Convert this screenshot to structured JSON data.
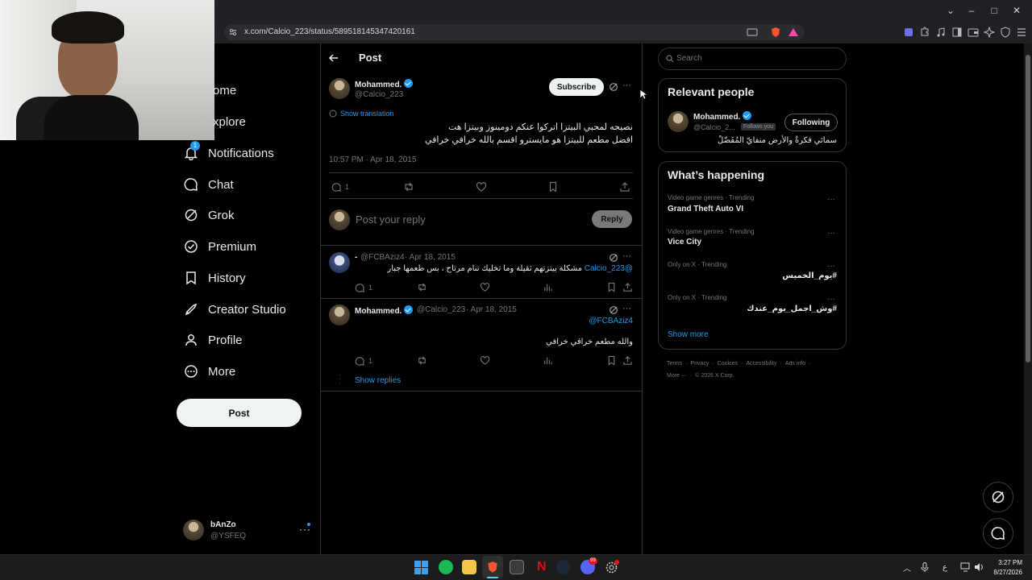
{
  "browser": {
    "url": "x.com/Calcio_223/status/589518145347420161"
  },
  "nav": {
    "items": [
      {
        "label": "Home",
        "visible_label": "ome",
        "icon": "home-icon"
      },
      {
        "label": "Explore",
        "visible_label": "xplore",
        "icon": "search-icon"
      },
      {
        "label": "Notifications",
        "icon": "bell-icon",
        "badge": "1"
      },
      {
        "label": "Chat",
        "icon": "chat-icon"
      },
      {
        "label": "Grok",
        "icon": "grok-icon"
      },
      {
        "label": "Premium",
        "icon": "premium-icon"
      },
      {
        "label": "History",
        "icon": "bookmark-icon"
      },
      {
        "label": "Creator Studio",
        "icon": "rocket-icon"
      },
      {
        "label": "Profile",
        "icon": "person-icon"
      },
      {
        "label": "More",
        "icon": "more-circle-icon"
      }
    ],
    "post_label": "Post",
    "account": {
      "name": "bAnZo",
      "handle": "@YSFEQ"
    }
  },
  "header": {
    "title": "Post"
  },
  "main_post": {
    "author": "Mohammed.",
    "handle": "@Calcio_223",
    "subscribe_label": "Subscribe",
    "show_translation": "Show translation",
    "text_line1": "نصيحه لمحبي البيتزا اتركوا عنكم دومينوز وبيتزا هت",
    "text_line2": "افضل مطعم للبيتزا هو مايسترو اقسم بالله خرافي خرافي",
    "timestamp": "10:57 PM · Apr 18, 2015",
    "reply_count": "1"
  },
  "reply_box": {
    "placeholder": "Post your reply",
    "button": "Reply"
  },
  "replies": [
    {
      "author": "-",
      "handle": "@FCBAziz4",
      "date": "· Apr 18, 2015",
      "mention": "@Calcio_223",
      "text": "مشكلة بيتزتهم ثقيلة وما تخليك تنام مرتاح ، بس طعمها جبار",
      "reply_count": "1"
    },
    {
      "author": "Mohammed.",
      "handle": "@Calcio_223",
      "date": "· Apr 18, 2015",
      "mention": "@FCBAziz4",
      "text": "والله مطعم خرافي خرافي",
      "reply_count": "1",
      "show_replies": "Show replies"
    }
  ],
  "sidebar": {
    "search_placeholder": "Search",
    "relevant": {
      "title": "Relevant people",
      "name": "Mohammed.",
      "handle": "@Calcio_2...",
      "follows_you": "Follows you",
      "button": "Following",
      "bio": "سمائي فكرةٌ والأرض منفايّ المُفَضّلْ"
    },
    "happening": {
      "title": "What’s happening",
      "trends": [
        {
          "meta": "Video game genres · Trending",
          "title": "Grand Theft Auto VI"
        },
        {
          "meta": "Video game genres · Trending",
          "title": "Vice City"
        },
        {
          "meta": "Only on X · Trending",
          "title": "#يوم_الخميس"
        },
        {
          "meta": "Only on X · Trending",
          "title": "#وش_اجمل_يوم_عندك"
        }
      ],
      "show_more": "Show more"
    },
    "footer": [
      "Terms",
      "Privacy",
      "Cookies",
      "Accessibility",
      "Ads info",
      "More ···",
      "© 2026 X Corp."
    ]
  },
  "taskbar": {
    "time": "3:27 PM",
    "date": "8/27/2026",
    "lang": "ع",
    "discord_badge": "99"
  }
}
